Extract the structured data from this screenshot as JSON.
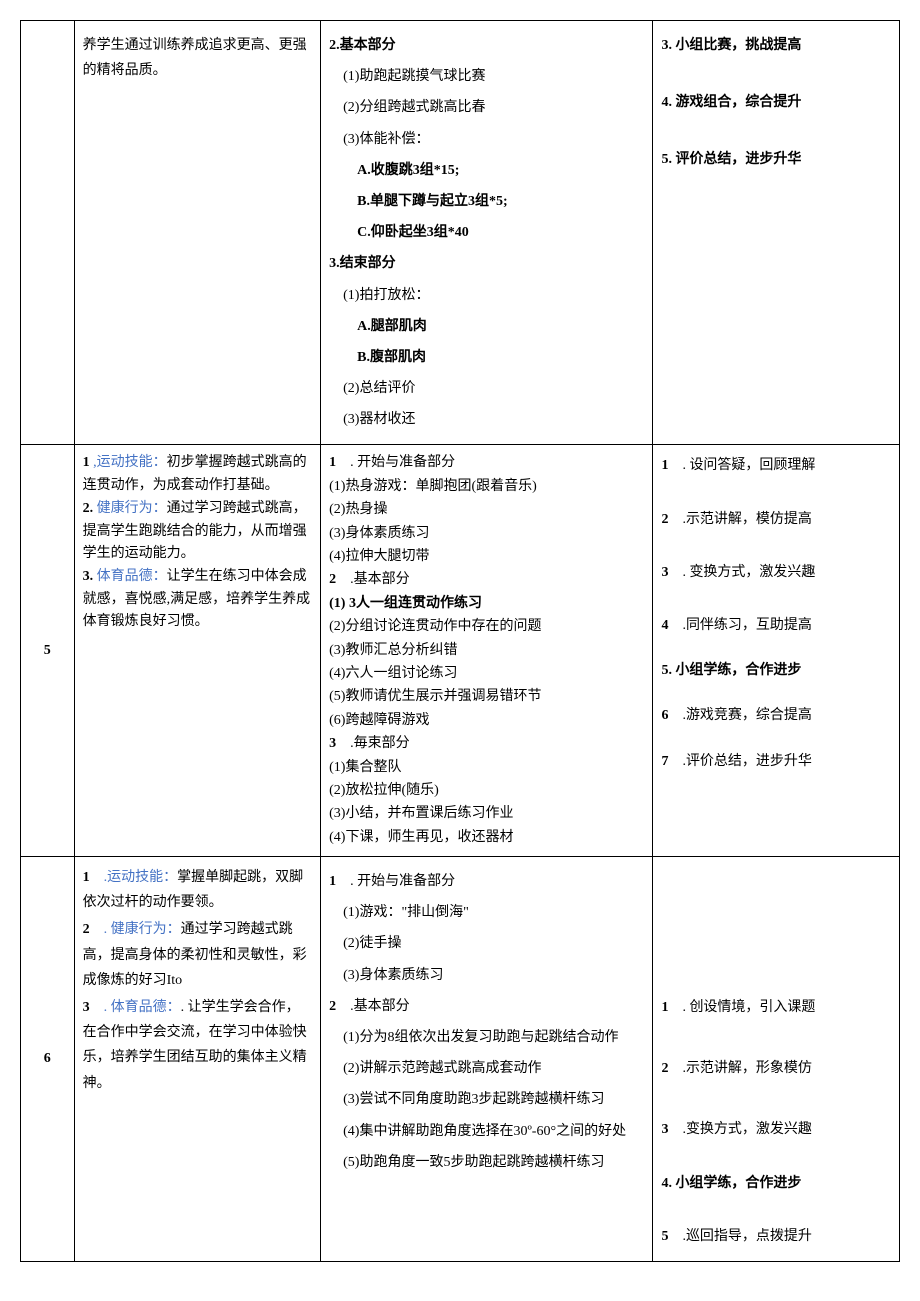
{
  "rows": [
    {
      "num": "",
      "goals": {
        "prefix": "养学生通过训练养成追求更高、更强的精将品质。"
      },
      "content": {
        "s2_title": "2.基本部分",
        "s2_1": "(1)助跑起跳摸气球比赛",
        "s2_2": "(2)分组跨越式跳高比春",
        "s2_3": "(3)体能补偿：",
        "s2_3a": "A.收腹跳3组*15;",
        "s2_3b": "B.单腿下蹲与起立3组*5;",
        "s2_3c": "C.仰卧起坐3组*40",
        "s3_title": "3.结束部分",
        "s3_1": "(1)拍打放松：",
        "s3_1a": "A.腿部肌肉",
        "s3_1b": "B.腹部肌肉",
        "s3_2": "(2)总结评价",
        "s3_3": "(3)器材收还"
      },
      "strategy": {
        "i3": "3. 小组比赛，挑战提高",
        "i4": "4. 游戏组合，综合提升",
        "i5": "5. 评价总结，进步升华"
      }
    },
    {
      "num": "5",
      "goals": {
        "g1_num": "1",
        "g1_label": ",运动技能：",
        "g1_text": "初步掌握跨越式跳高的连贯动作，为成套动作打基础。",
        "g2_num": "2.",
        "g2_label": "健康行为：",
        "g2_text": "通过学习跨越式跳高，提高学生跑跳结合的能力，从而增强学生的运动能力。",
        "g3_num": "3.",
        "g3_label": "体育品德：",
        "g3_text": "让学生在练习中体会成就感，喜悦感,满足感，培养学生养成体育锻炼良好习惯。"
      },
      "content": {
        "s1_num": "1",
        "s1_title": ". 开始与准备部分",
        "s1_1": "(1)热身游戏：单脚抱团(跟着音乐)",
        "s1_2": "(2)热身操",
        "s1_3": "(3)身体素质练习",
        "s1_4": "(4)拉伸大腿切带",
        "s2_num": "2",
        "s2_title": ".基本部分",
        "s2_1": "(1)   3人一组连贯动作练习",
        "s2_2": "(2)分组讨论连贯动作中存在的问题",
        "s2_3": "(3)教师汇总分析纠错",
        "s2_4": "(4)六人一组讨论练习",
        "s2_5": "(5)教师请优生展示并强调易错环节",
        "s2_6": "(6)跨越障碍游戏",
        "s3_num": "3",
        "s3_title": ".毎束部分",
        "s3_1": "(1)集合整队",
        "s3_2": "(2)放松拉伸(随乐)",
        "s3_3": "(3)小结，并布置课后练习作业",
        "s3_4": "(4)下课，师生再见，收还器材"
      },
      "strategy": {
        "i1_num": "1",
        "i1": ". 设问答疑，回顾理解",
        "i2_num": "2",
        "i2": ".示范讲解，模仿提高",
        "i3_num": "3",
        "i3": ". 变换方式，激发兴趣",
        "i4_num": "4",
        "i4": ".同伴练习，互助提高",
        "i5": "5. 小组学练，合作进步",
        "i6_num": "6",
        "i6": ".游戏竞赛，综合提高",
        "i7_num": "7",
        "i7": ".评价总结，进步升华"
      }
    },
    {
      "num": "6",
      "goals": {
        "g1_num": "1",
        "g1_label": ".运动技能：",
        "g1_text": "掌握单脚起跳，双脚依次过杆的动作要领。",
        "g2_num": "2",
        "g2_label": ". 健康行为：",
        "g2_text": "通过学习跨越式跳高，提高身体的柔初性和灵敏性，彩成像炼的好习Ito",
        "g3_num": "3",
        "g3_label": ". 体育品德：",
        "g3_text": ". 让学生学会合作，在合作中学会交流，在学习中体验快乐，培养学生团结互助的集体主义精神。"
      },
      "content": {
        "s1_num": "1",
        "s1_title": ". 开始与准备部分",
        "s1_1": "(1)游戏：\"排山倒海\"",
        "s1_2": "(2)徒手操",
        "s1_3": "(3)身体素质练习",
        "s2_num": "2",
        "s2_title": ".基本部分",
        "s2_1": "(1)分为8组依次出发复习助跑与起跳结合动作",
        "s2_2": "(2)讲解示范跨越式跳高成套动作",
        "s2_3": "(3)尝试不同角度助跑3步起跳跨越横杆练习",
        "s2_4": "(4)集中讲解助跑角度选择在30º-60°之间的好处",
        "s2_5": "(5)助跑角度一致5步助跑起跳跨越横杆练习"
      },
      "strategy": {
        "i1_num": "1",
        "i1": ". 创设情境，引入课题",
        "i2_num": "2",
        "i2": ".示范讲解，形象模仿",
        "i3_num": "3",
        "i3": ".变换方式，激发兴趣",
        "i4": "4. 小组学练，合作进步",
        "i5_num": "5",
        "i5": ".巡回指导，点拨提升"
      }
    }
  ]
}
